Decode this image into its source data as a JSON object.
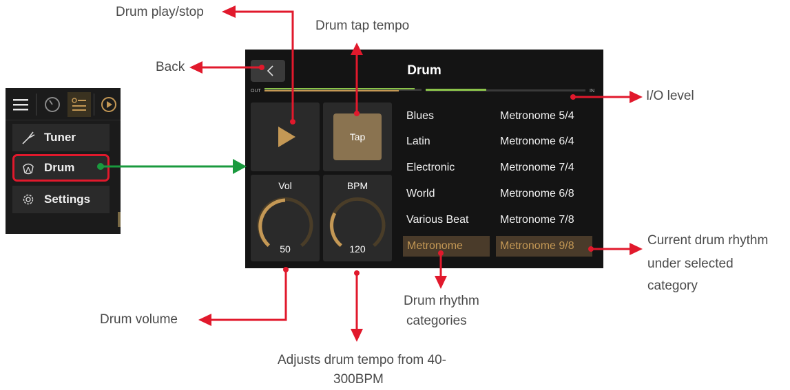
{
  "callouts": {
    "play_stop": "Drum play/stop",
    "tap_tempo": "Drum tap tempo",
    "back": "Back",
    "io_level": "I/O level",
    "current_rhythm_1": "Current drum rhythm",
    "current_rhythm_2": "under selected",
    "current_rhythm_3": "category",
    "categories_1": "Drum rhythm",
    "categories_2": "categories",
    "volume": "Drum volume",
    "tempo_1": "Adjusts drum tempo from 40-",
    "tempo_2": "300BPM"
  },
  "menu": {
    "items": [
      {
        "label": "Tuner",
        "icon": "tuning-fork-icon"
      },
      {
        "label": "Drum",
        "icon": "drum-icon",
        "selected": true
      },
      {
        "label": "Settings",
        "icon": "gear-icon"
      }
    ]
  },
  "screen": {
    "title": "Drum",
    "level": {
      "out_label": "OUT",
      "in_label": "IN"
    },
    "tap_label": "Tap",
    "vol": {
      "label": "Vol",
      "value": "50"
    },
    "bpm": {
      "label": "BPM",
      "value": "120"
    },
    "categories": [
      "Blues",
      "Latin",
      "Electronic",
      "World",
      "Various Beat",
      "Metronome"
    ],
    "selected_category": "Metronome",
    "rhythms": [
      "Metronome 5/4",
      "Metronome 6/4",
      "Metronome 7/4",
      "Metronome 6/8",
      "Metronome 7/8",
      "Metronome 9/8"
    ],
    "selected_rhythm": "Metronome 9/8"
  },
  "colors": {
    "accent_gold": "#c49855",
    "arrow_red": "#e1192c",
    "arrow_green": "#1a9a3e",
    "level_green": "#8bc34a"
  }
}
